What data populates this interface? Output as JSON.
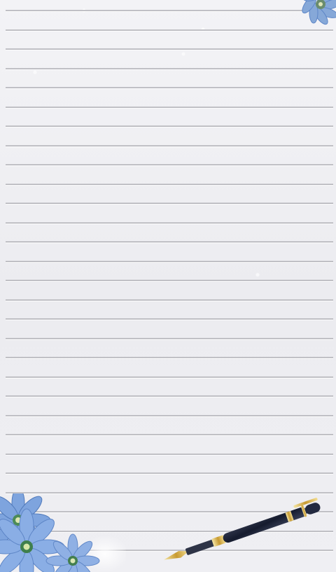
{
  "page": {
    "background": "#eeeef2",
    "line_color": "#c0c0c5"
  },
  "ruled_lines": {
    "count": 29
  },
  "decorations": {
    "top_flower_icon": "blue-flower-icon",
    "bottom_flowers_icon": "blue-flowers-icon",
    "pen_icon": "fountain-pen-icon"
  }
}
